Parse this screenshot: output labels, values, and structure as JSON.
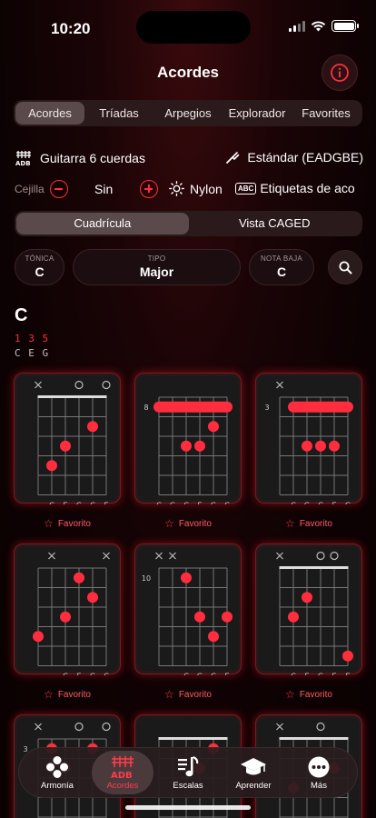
{
  "status": {
    "time": "10:20"
  },
  "nav": {
    "title": "Acordes"
  },
  "top_tabs": [
    {
      "label": "Acordes",
      "active": true
    },
    {
      "label": "Tríadas",
      "active": false
    },
    {
      "label": "Arpegios",
      "active": false
    },
    {
      "label": "Explorador",
      "active": false
    },
    {
      "label": "Favorites",
      "active": false
    }
  ],
  "instrument": {
    "label": "Guitarra 6 cuerdas",
    "tuning": "Estándar (EADGBE)"
  },
  "capo": {
    "label": "Cejilla",
    "value": "Sin"
  },
  "strings_type": "Nylon",
  "labels_toggle": "Etiquetas de aco",
  "view_tabs": [
    {
      "label": "Cuadrícula",
      "active": true
    },
    {
      "label": "Vista CAGED",
      "active": false
    }
  ],
  "selectors": {
    "tonic": {
      "label": "TÓNICA",
      "value": "C"
    },
    "type": {
      "label": "TIPO",
      "value": "Major"
    },
    "bass": {
      "label": "NOTA BAJA",
      "value": "C"
    }
  },
  "chord": {
    "name": "C",
    "intervals": "1 3 5",
    "notes": "C E G"
  },
  "favorite_label": "Favorito",
  "accent_color": "#ff2d3d",
  "voicings": [
    {
      "fret_label": "",
      "nut": true,
      "marks": [
        "x",
        "",
        "",
        "o",
        "",
        "o"
      ],
      "dots": [
        [
          1,
          3
        ],
        [
          2,
          2
        ],
        [
          4,
          1
        ]
      ],
      "barre": null,
      "note_labels": [
        "",
        "C",
        "E",
        "G",
        "C",
        "E"
      ]
    },
    {
      "fret_label": "8",
      "nut": false,
      "marks": [
        "",
        "",
        "",
        "",
        "",
        ""
      ],
      "dots": [
        [
          2,
          2
        ],
        [
          3,
          2
        ],
        [
          4,
          1
        ]
      ],
      "barre": [
        0,
        5,
        0
      ],
      "note_labels": [
        "C",
        "G",
        "C",
        "E",
        "G",
        "C"
      ]
    },
    {
      "fret_label": "3",
      "nut": false,
      "marks": [
        "x",
        "",
        "",
        "",
        "",
        ""
      ],
      "dots": [
        [
          2,
          2
        ],
        [
          3,
          2
        ],
        [
          4,
          2
        ]
      ],
      "barre": [
        1,
        5,
        0
      ],
      "note_labels": [
        "",
        "C",
        "G",
        "C",
        "E",
        "G"
      ]
    },
    {
      "fret_label": "",
      "nut": false,
      "marks": [
        "",
        "x",
        "",
        "",
        "",
        "x"
      ],
      "dots": [
        [
          0,
          3
        ],
        [
          2,
          2
        ],
        [
          3,
          0
        ],
        [
          4,
          1
        ]
      ],
      "barre": null,
      "note_labels": [
        "",
        "",
        "C",
        "E",
        "G",
        "C"
      ]
    },
    {
      "fret_label": "10",
      "nut": false,
      "marks": [
        "x",
        "x",
        "",
        "",
        "",
        ""
      ],
      "dots": [
        [
          2,
          0
        ],
        [
          3,
          2
        ],
        [
          4,
          3
        ],
        [
          5,
          2
        ]
      ],
      "barre": null,
      "note_labels": [
        "",
        "",
        "C",
        "G",
        "C",
        "E"
      ]
    },
    {
      "fret_label": "",
      "nut": true,
      "marks": [
        "x",
        "",
        "",
        "o",
        "o",
        ""
      ],
      "dots": [
        [
          1,
          2
        ],
        [
          2,
          1
        ],
        [
          5,
          4
        ]
      ],
      "barre": null,
      "note_labels": [
        "",
        "C",
        "E",
        "G",
        "E",
        "E"
      ]
    },
    {
      "fret_label": "3",
      "nut": false,
      "marks": [
        "x",
        "",
        "",
        "o",
        "",
        "o"
      ],
      "dots": [
        [
          1,
          0
        ],
        [
          2,
          1
        ],
        [
          4,
          0
        ]
      ],
      "barre": null,
      "note_labels": [
        "",
        "",
        "",
        "",
        "",
        ""
      ]
    },
    {
      "fret_label": "",
      "nut": true,
      "marks": [
        "",
        "",
        "",
        "",
        "",
        ""
      ],
      "dots": [
        [
          3,
          1
        ],
        [
          4,
          0
        ]
      ],
      "barre": null,
      "note_labels": [
        "",
        "",
        "",
        "",
        "",
        ""
      ]
    },
    {
      "fret_label": "",
      "nut": true,
      "marks": [
        "x",
        "",
        "",
        "o",
        "",
        ""
      ],
      "dots": [
        [
          4,
          1
        ],
        [
          1,
          2
        ]
      ],
      "barre": null,
      "note_labels": [
        "",
        "",
        "",
        "",
        "",
        ""
      ]
    }
  ],
  "tabbar": [
    {
      "label": "Armonía",
      "icon": "harmony-icon",
      "active": false
    },
    {
      "label": "Acordes",
      "icon": "guitar-chord-icon",
      "active": true
    },
    {
      "label": "Escalas",
      "icon": "music-note-icon",
      "active": false
    },
    {
      "label": "Aprender",
      "icon": "graduation-cap-icon",
      "active": false
    },
    {
      "label": "Más",
      "icon": "more-icon",
      "active": false
    }
  ]
}
